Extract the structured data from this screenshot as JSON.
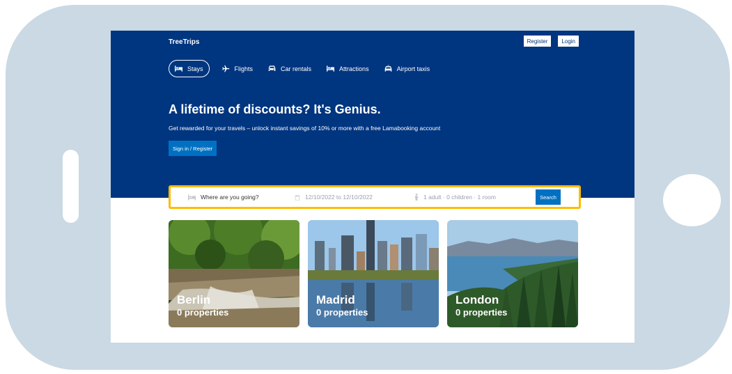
{
  "header": {
    "brand": "TreeTrips",
    "register_label": "Register",
    "login_label": "Login"
  },
  "nav": {
    "items": [
      {
        "label": "Stays",
        "icon": "bed-icon",
        "active": true
      },
      {
        "label": "Flights",
        "icon": "plane-icon"
      },
      {
        "label": "Car rentals",
        "icon": "car-icon"
      },
      {
        "label": "Attractions",
        "icon": "bed-icon"
      },
      {
        "label": "Airport taxis",
        "icon": "taxi-icon"
      }
    ]
  },
  "hero": {
    "title": "A lifetime of discounts? It's Genius.",
    "description": "Get rewarded for your travels – unlock instant savings of 10% or more with a free Lamabooking account",
    "signin_label": "Sign in / Register"
  },
  "search": {
    "destination_placeholder": "Where are you going?",
    "dates": "12/10/2022 to 12/10/2022",
    "options": "1 adult · 0 children · 1 room",
    "button_label": "Search"
  },
  "featured": [
    {
      "city": "Berlin",
      "count": "0 properties"
    },
    {
      "city": "Madrid",
      "count": "0 properties"
    },
    {
      "city": "London",
      "count": "0 properties"
    }
  ],
  "colors": {
    "brand_blue": "#003580",
    "button_blue": "#0071c2",
    "search_border": "#febb02",
    "frame": "#cad9e3"
  }
}
